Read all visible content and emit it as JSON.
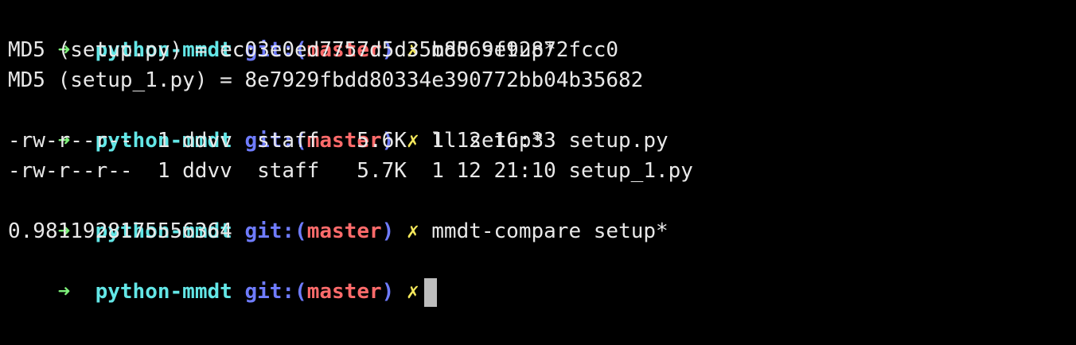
{
  "prompt": {
    "arrow": "➜",
    "dir": "python-mmdt",
    "git_prefix": "git:(",
    "branch": "master",
    "git_suffix": ")",
    "dirty": "✗"
  },
  "lines": [
    {
      "type": "prompt",
      "command": "md5 setup*"
    },
    {
      "type": "output",
      "text": "MD5 (setup.py) = ec03e0ed7757d5d35b8069f92872fcc0"
    },
    {
      "type": "output",
      "text": "MD5 (setup_1.py) = 8e7929fbdd80334e390772bb04b35682"
    },
    {
      "type": "prompt",
      "command": "ll setup*"
    },
    {
      "type": "output",
      "text": "-rw-r--r--  1 ddvv  staff   5.6K  1 12 16:33 setup.py"
    },
    {
      "type": "output",
      "text": "-rw-r--r--  1 ddvv  staff   5.7K  1 12 21:10 setup_1.py"
    },
    {
      "type": "prompt",
      "command": "mmdt-compare setup*"
    },
    {
      "type": "output",
      "text": "0.9811928175556364"
    },
    {
      "type": "prompt",
      "command": ""
    }
  ],
  "colors": {
    "background": "#000000",
    "arrow": "#7ef07a",
    "dir": "#63e6e6",
    "git": "#6f7cff",
    "branch": "#ff6b6b",
    "dirty": "#f3e75b",
    "text": "#e8e8e8",
    "cursor": "#bdbdbd"
  }
}
